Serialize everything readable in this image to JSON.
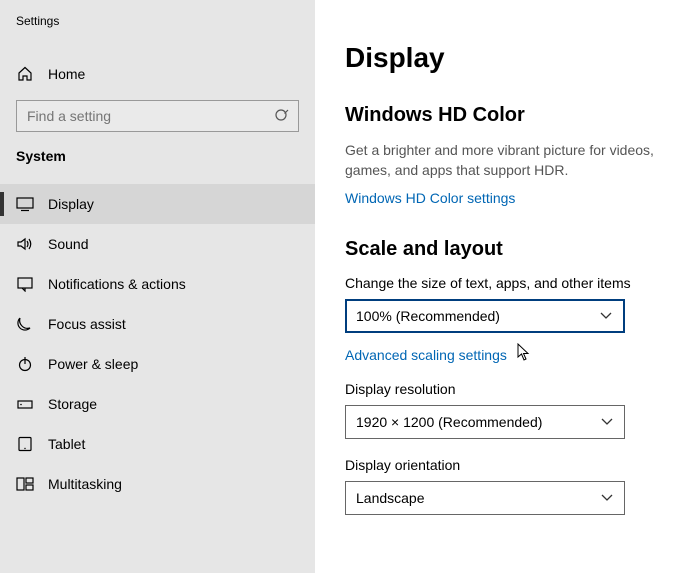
{
  "window": {
    "title": "Settings"
  },
  "sidebar": {
    "home": "Home",
    "search_placeholder": "Find a setting",
    "section": "System",
    "items": [
      {
        "label": "Display"
      },
      {
        "label": "Sound"
      },
      {
        "label": "Notifications & actions"
      },
      {
        "label": "Focus assist"
      },
      {
        "label": "Power & sleep"
      },
      {
        "label": "Storage"
      },
      {
        "label": "Tablet"
      },
      {
        "label": "Multitasking"
      }
    ]
  },
  "main": {
    "page_title": "Display",
    "hd_color": {
      "title": "Windows HD Color",
      "desc": "Get a brighter and more vibrant picture for videos, games, and apps that support HDR.",
      "link": "Windows HD Color settings"
    },
    "scale_layout": {
      "title": "Scale and layout",
      "text_size_label": "Change the size of text, apps, and other items",
      "text_size_value": "100% (Recommended)",
      "advanced_link": "Advanced scaling settings",
      "resolution_label": "Display resolution",
      "resolution_value": "1920 × 1200 (Recommended)",
      "orientation_label": "Display orientation",
      "orientation_value": "Landscape"
    }
  }
}
